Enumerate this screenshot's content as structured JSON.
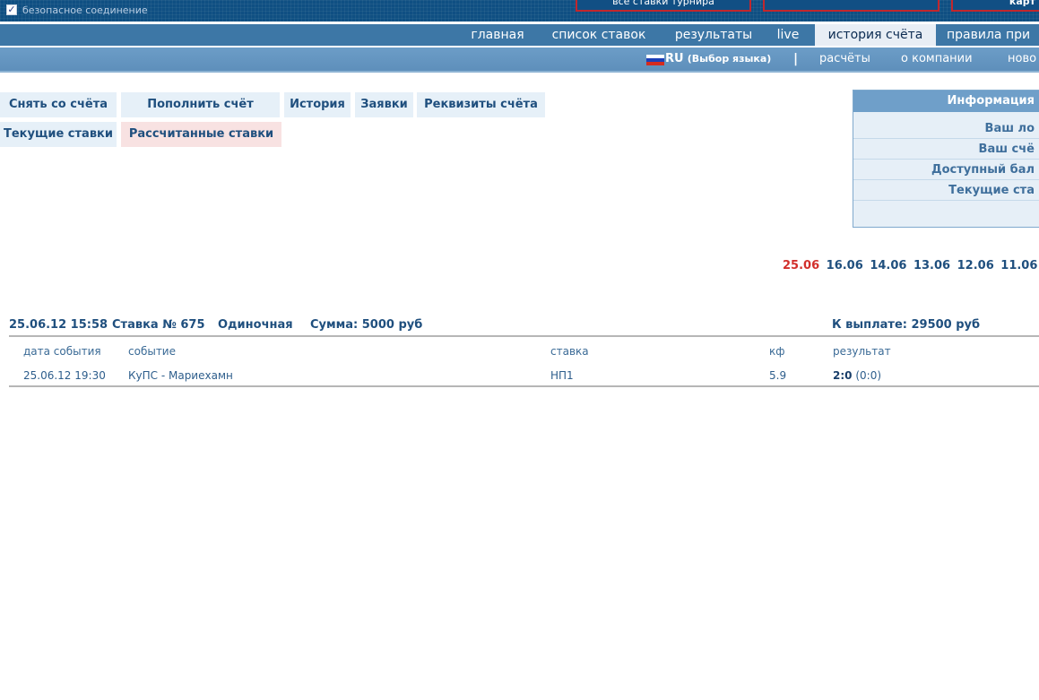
{
  "header": {
    "secure_label": "безопасное соединение",
    "buttons": [
      "все ставки турнира",
      "",
      "карт"
    ]
  },
  "main_nav": [
    {
      "label": "главная"
    },
    {
      "label": "список ставок"
    },
    {
      "label": "результаты"
    },
    {
      "label": "live"
    },
    {
      "label": "история счёта",
      "active": true
    },
    {
      "label": "правила при"
    }
  ],
  "sub_nav": {
    "lang_code": "RU",
    "lang_select": "(Выбор языка)",
    "separator": "|",
    "items": [
      {
        "label": "расчёты"
      },
      {
        "label": "о компании"
      },
      {
        "label": "ново"
      }
    ]
  },
  "account_tabs": [
    {
      "label": "Снять со счёта"
    },
    {
      "label": "Пополнить счёт"
    },
    {
      "label": "История"
    },
    {
      "label": "Заявки"
    },
    {
      "label": "Реквизиты счёта"
    },
    {
      "label": "Текущие ставки"
    },
    {
      "label": "Рассчитанные ставки",
      "active": true
    }
  ],
  "info_panel": {
    "title": "Информация",
    "rows": [
      "Ваш ло",
      "Ваш счё",
      "Доступный бал",
      "Текущие ста"
    ]
  },
  "dates": [
    {
      "label": "25.06",
      "active": true
    },
    {
      "label": "16.06"
    },
    {
      "label": "14.06"
    },
    {
      "label": "13.06"
    },
    {
      "label": "12.06"
    },
    {
      "label": "11.06"
    }
  ],
  "bet": {
    "datetime": "25.06.12 15:58",
    "number_label": "Ставка № 675",
    "type": "Одиночная",
    "sum": "Сумма: 5000 руб",
    "payout": "К выплате: 29500  руб"
  },
  "table": {
    "headers": [
      "дата события",
      "событие",
      "ставка",
      "кф",
      "результат"
    ],
    "rows": [
      {
        "date": "25.06.12 19:30",
        "event": "КуПС - Мариехамн",
        "bet": "НП1",
        "coef": "5.9",
        "result_main": "2:0",
        "result_half": "(0:0)"
      }
    ]
  },
  "colors": {
    "accent": "#1f4f7e",
    "active_date": "#d2302c",
    "nav_bg": "#3d77a6"
  }
}
